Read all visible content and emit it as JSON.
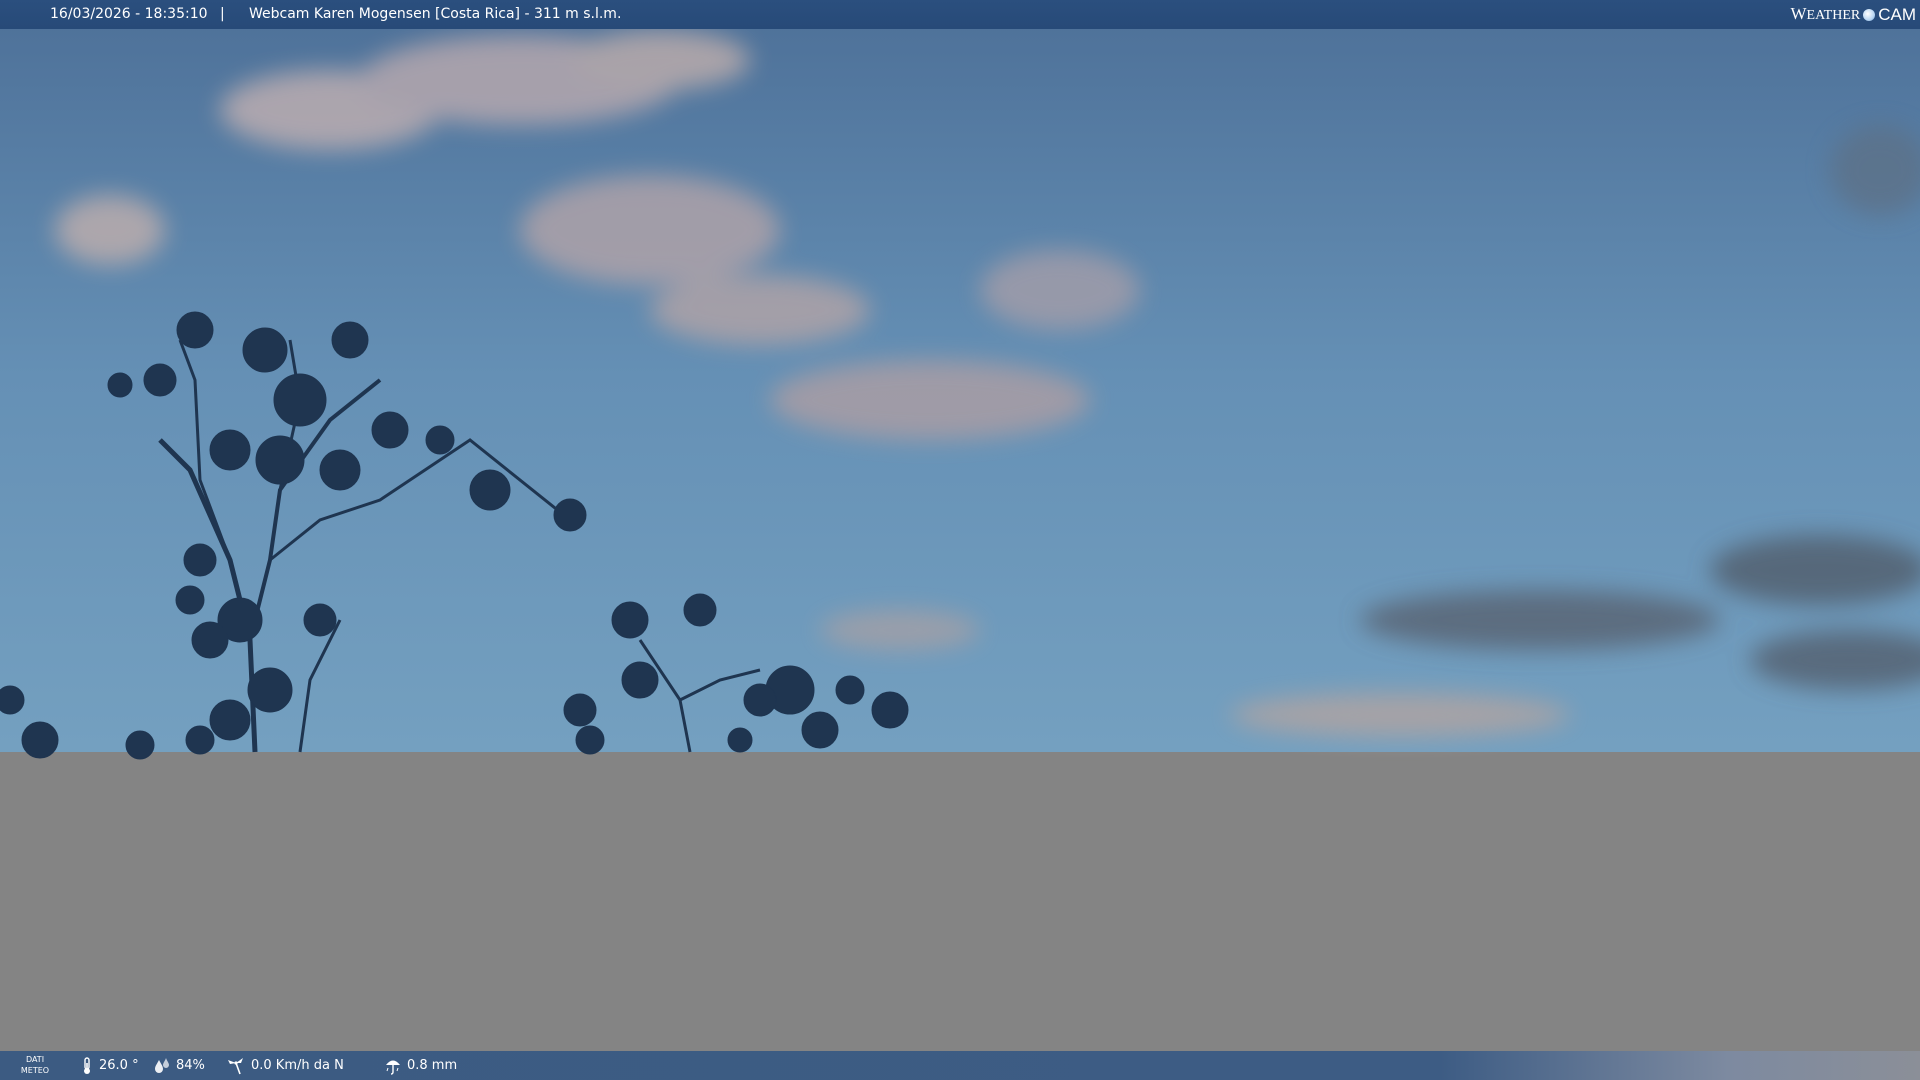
{
  "header": {
    "timestamp": "16/03/2026 - 18:35:10",
    "separator": "|",
    "title": "Webcam Karen Mogensen [Costa Rica] - 311 m s.l.m."
  },
  "logo": {
    "weather_w": "W",
    "weather_rest": "EATHER",
    "cam": "CAM"
  },
  "weather_bar": {
    "label_line1": "DATI",
    "label_line2": "METEO",
    "temperature": "26.0 °",
    "humidity": "84%",
    "wind": "0.0 Km/h da N",
    "rain": "0.8 mm"
  },
  "icons": {
    "temperature": "thermometer-icon",
    "humidity": "humidity-icon",
    "wind": "wind-icon",
    "rain": "rain-icon"
  },
  "colors": {
    "header_bg": "#2b4f7e",
    "sky_top": "#4e7299",
    "sky_bottom": "#6f9bbd",
    "lower_gray": "#848484"
  }
}
